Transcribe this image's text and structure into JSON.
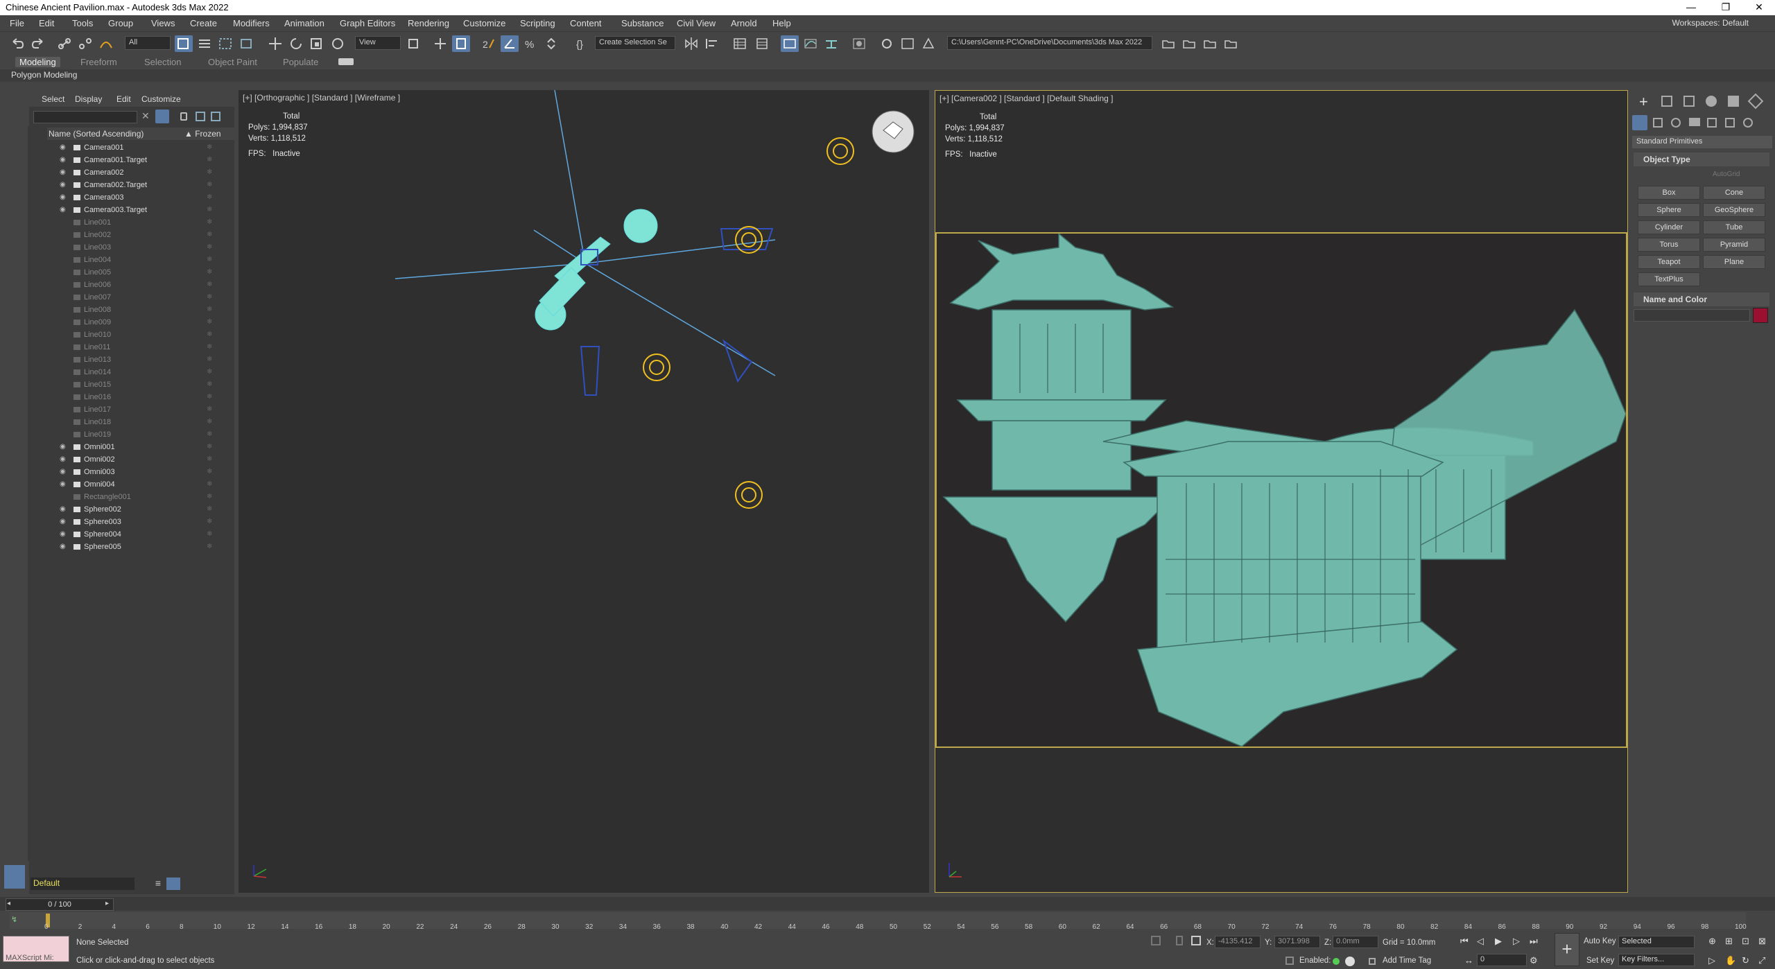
{
  "window": {
    "title": "Chinese Ancient Pavilion.max - Autodesk 3ds Max 2022",
    "min": "—",
    "max": "❐",
    "close": "✕"
  },
  "menu": [
    "File",
    "Edit",
    "Tools",
    "Group",
    "Views",
    "Create",
    "Modifiers",
    "Animation",
    "Graph Editors",
    "Rendering",
    "Customize",
    "Scripting",
    "Content",
    "Substance",
    "Civil View",
    "Arnold",
    "Help"
  ],
  "workspace": "Workspaces: Default",
  "toolbar": {
    "filter": "All",
    "ref_coord": "View",
    "selection_set": "Create Selection Se",
    "project_path": "C:\\Users\\Gennt-PC\\OneDrive\\Documents\\3ds Max 2022"
  },
  "ribbon": {
    "tabs": [
      "Modeling",
      "Freeform",
      "Selection",
      "Object Paint",
      "Populate"
    ],
    "sub": "Polygon Modeling"
  },
  "scene_explorer": {
    "menu": [
      "Select",
      "Display",
      "Edit",
      "Customize"
    ],
    "col_name": "Name (Sorted Ascending)",
    "col_frozen": "▲ Frozen",
    "rows": [
      {
        "name": "Camera001",
        "dim": false
      },
      {
        "name": "Camera001.Target",
        "dim": false
      },
      {
        "name": "Camera002",
        "dim": false
      },
      {
        "name": "Camera002.Target",
        "dim": false
      },
      {
        "name": "Camera003",
        "dim": false
      },
      {
        "name": "Camera003.Target",
        "dim": false
      },
      {
        "name": "Line001",
        "dim": true
      },
      {
        "name": "Line002",
        "dim": true
      },
      {
        "name": "Line003",
        "dim": true
      },
      {
        "name": "Line004",
        "dim": true
      },
      {
        "name": "Line005",
        "dim": true
      },
      {
        "name": "Line006",
        "dim": true
      },
      {
        "name": "Line007",
        "dim": true
      },
      {
        "name": "Line008",
        "dim": true
      },
      {
        "name": "Line009",
        "dim": true
      },
      {
        "name": "Line010",
        "dim": true
      },
      {
        "name": "Line011",
        "dim": true
      },
      {
        "name": "Line013",
        "dim": true
      },
      {
        "name": "Line014",
        "dim": true
      },
      {
        "name": "Line015",
        "dim": true
      },
      {
        "name": "Line016",
        "dim": true
      },
      {
        "name": "Line017",
        "dim": true
      },
      {
        "name": "Line018",
        "dim": true
      },
      {
        "name": "Line019",
        "dim": true
      },
      {
        "name": "Omni001",
        "dim": false
      },
      {
        "name": "Omni002",
        "dim": false
      },
      {
        "name": "Omni003",
        "dim": false
      },
      {
        "name": "Omni004",
        "dim": false
      },
      {
        "name": "Rectangle001",
        "dim": true
      },
      {
        "name": "Sphere002",
        "dim": false
      },
      {
        "name": "Sphere003",
        "dim": false
      },
      {
        "name": "Sphere004",
        "dim": false
      },
      {
        "name": "Sphere005",
        "dim": false
      }
    ],
    "layer": "Default"
  },
  "viewport1": {
    "label": "[+] [Orthographic ] [Standard ] [Wireframe ]",
    "stats_total": "Total",
    "polys_label": "Polys:",
    "polys": "1,994,837",
    "verts_label": "Verts:",
    "verts": "1,118,512",
    "fps_label": "FPS:",
    "fps": "Inactive"
  },
  "viewport2": {
    "label": "[+] [Camera002 ] [Standard ] [Default Shading ]",
    "stats_total": "Total",
    "polys_label": "Polys:",
    "polys": "1,994,837",
    "verts_label": "Verts:",
    "verts": "1,118,512",
    "fps_label": "FPS:",
    "fps": "Inactive"
  },
  "command_panel": {
    "dropdown": "Standard Primitives",
    "object_type": "Object Type",
    "autogrid": "AutoGrid",
    "buttons": [
      "Box",
      "Cone",
      "Sphere",
      "GeoSphere",
      "Cylinder",
      "Tube",
      "Torus",
      "Pyramid",
      "Teapot",
      "Plane",
      "TextPlus"
    ],
    "name_color": "Name and Color",
    "color": "#9a1030"
  },
  "timeline": {
    "frame": "0 / 100",
    "ticks": [
      "0",
      "2",
      "4",
      "6",
      "8",
      "10",
      "12",
      "14",
      "16",
      "18",
      "20",
      "22",
      "24",
      "26",
      "28",
      "30",
      "32",
      "34",
      "36",
      "38",
      "40",
      "42",
      "44",
      "46",
      "48",
      "50",
      "52",
      "54",
      "56",
      "58",
      "60",
      "62",
      "64",
      "66",
      "68",
      "70",
      "72",
      "74",
      "76",
      "78",
      "80",
      "82",
      "84",
      "86",
      "88",
      "90",
      "92",
      "94",
      "96",
      "98",
      "100"
    ]
  },
  "status": {
    "maxscript": "MAXScript Mi:",
    "selected": "None Selected",
    "hint": "Click or click-and-drag to select objects",
    "x_label": "X:",
    "x": "-4135.412",
    "y_label": "Y:",
    "y": "3071.998",
    "z_label": "Z:",
    "z": "0.0mm",
    "grid": "Grid = 10.0mm",
    "enabled": "Enabled:",
    "add_time_tag": "Add Time Tag",
    "auto_key": "Auto Key",
    "selected_dd": "Selected",
    "set_key": "Set Key",
    "key_filters": "Key Filters...",
    "frame_field": "0"
  }
}
